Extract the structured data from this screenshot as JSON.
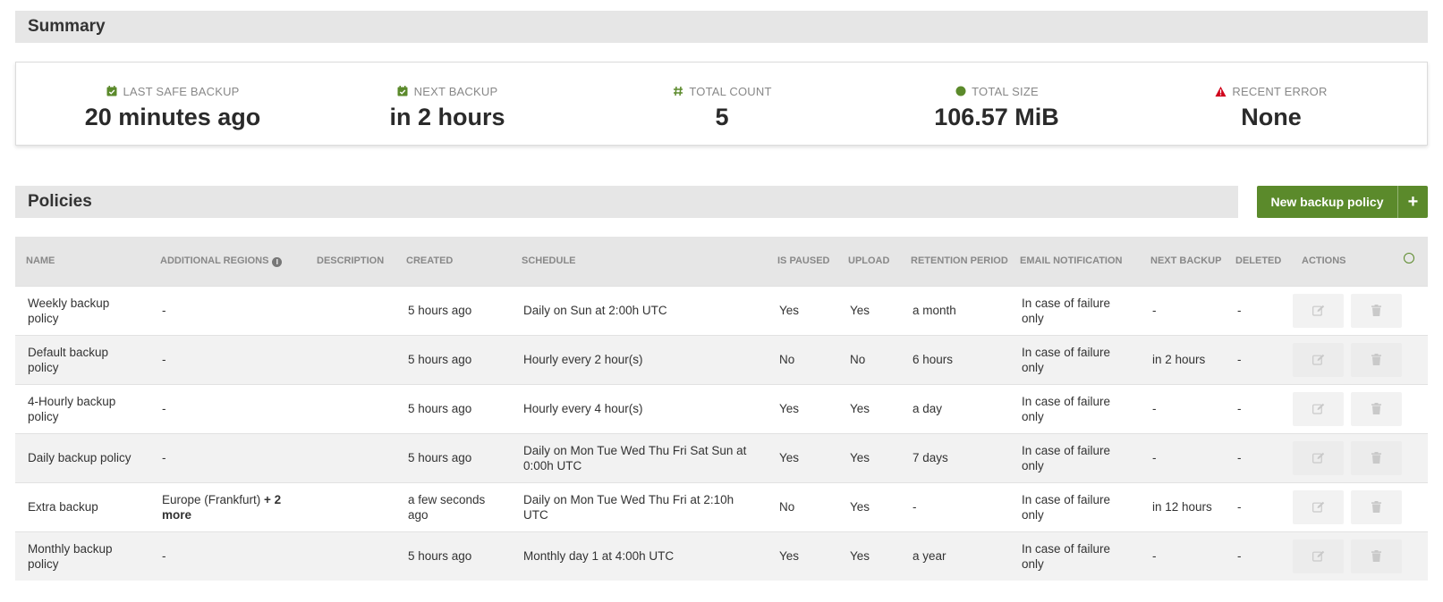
{
  "summary": {
    "title": "Summary",
    "stats": [
      {
        "label": "LAST SAFE BACKUP",
        "value": "20 minutes ago",
        "icon": "calendar-check-icon"
      },
      {
        "label": "NEXT BACKUP",
        "value": "in 2 hours",
        "icon": "calendar-check-icon"
      },
      {
        "label": "TOTAL COUNT",
        "value": "5",
        "icon": "hash-icon"
      },
      {
        "label": "TOTAL SIZE",
        "value": "106.57 MiB",
        "icon": "circle-icon"
      },
      {
        "label": "RECENT ERROR",
        "value": "None",
        "icon": "warning-icon"
      }
    ]
  },
  "colors": {
    "accent": "#5b8a2b",
    "error": "#d0021b",
    "header_bg": "#e6e6e6"
  },
  "policies": {
    "title": "Policies",
    "new_button_label": "New backup policy",
    "new_button_icon": "plus-icon",
    "columns": {
      "name": "NAME",
      "regions": "ADDITIONAL REGIONS",
      "description": "DESCRIPTION",
      "created": "CREATED",
      "schedule": "SCHEDULE",
      "paused": "IS PAUSED",
      "upload": "UPLOAD",
      "retention": "RETENTION PERIOD",
      "email": "EMAIL NOTIFICATION",
      "next": "NEXT BACKUP",
      "deleted": "DELETED",
      "actions": "ACTIONS"
    },
    "rows": [
      {
        "name": "Weekly backup policy",
        "regions": "-",
        "regions_more": "",
        "description": "",
        "created": "5 hours ago",
        "schedule": "Daily on Sun at 2:00h UTC",
        "paused": "Yes",
        "upload": "Yes",
        "retention": "a month",
        "email": "In case of failure only",
        "next": "-",
        "deleted": "-"
      },
      {
        "name": "Default backup policy",
        "regions": "-",
        "regions_more": "",
        "description": "",
        "created": "5 hours ago",
        "schedule": "Hourly every 2 hour(s)",
        "paused": "No",
        "upload": "No",
        "retention": "6 hours",
        "email": "In case of failure only",
        "next": "in 2 hours",
        "deleted": "-"
      },
      {
        "name": "4-Hourly backup policy",
        "regions": "-",
        "regions_more": "",
        "description": "",
        "created": "5 hours ago",
        "schedule": "Hourly every 4 hour(s)",
        "paused": "Yes",
        "upload": "Yes",
        "retention": "a day",
        "email": "In case of failure only",
        "next": "-",
        "deleted": "-"
      },
      {
        "name": "Daily backup policy",
        "regions": "-",
        "regions_more": "",
        "description": "",
        "created": "5 hours ago",
        "schedule": "Daily on Mon Tue Wed Thu Fri Sat Sun at 0:00h UTC",
        "paused": "Yes",
        "upload": "Yes",
        "retention": "7 days",
        "email": "In case of failure only",
        "next": "-",
        "deleted": "-"
      },
      {
        "name": "Extra backup",
        "regions": "Europe (Frankfurt)",
        "regions_more": "+ 2 more",
        "description": "",
        "created": "a few seconds ago",
        "schedule": "Daily on Mon Tue Wed Thu Fri at 2:10h UTC",
        "paused": "No",
        "upload": "Yes",
        "retention": "-",
        "email": "In case of failure only",
        "next": "in 12 hours",
        "deleted": "-"
      },
      {
        "name": "Monthly backup policy",
        "regions": "-",
        "regions_more": "",
        "description": "",
        "created": "5 hours ago",
        "schedule": "Monthly day 1 at 4:00h UTC",
        "paused": "Yes",
        "upload": "Yes",
        "retention": "a year",
        "email": "In case of failure only",
        "next": "-",
        "deleted": "-"
      }
    ]
  }
}
